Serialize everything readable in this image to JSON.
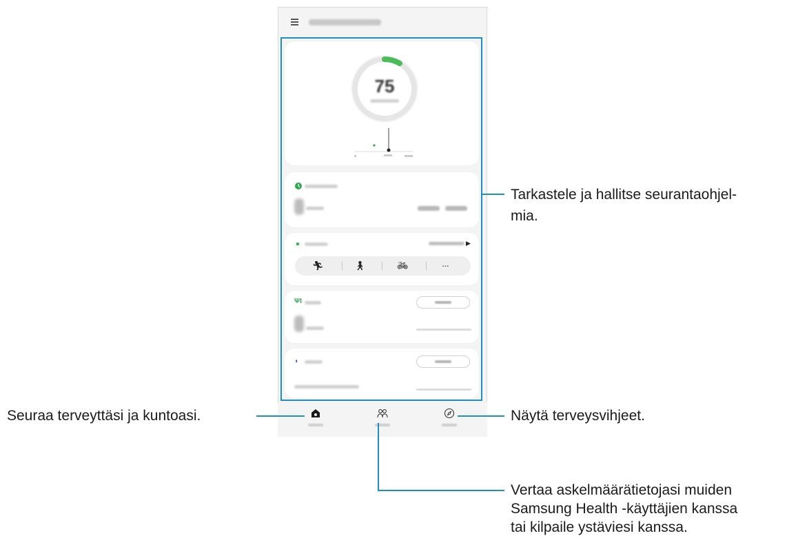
{
  "app": {
    "ring_value": "75"
  },
  "nav": {
    "items": [
      {
        "icon": "home-icon"
      },
      {
        "icon": "together-icon"
      },
      {
        "icon": "discover-icon"
      }
    ]
  },
  "exercise_icons": [
    "running-icon",
    "walking-icon",
    "cycling-icon",
    "more-icon"
  ],
  "callouts": {
    "trackers_line1": "Tarkastele ja hallitse seurantaohjel-",
    "trackers_line2": "mia.",
    "home": "Seuraa terveyttäsi ja kuntoasi.",
    "discover": "Näytä terveysvihjeet.",
    "together_line1": "Vertaa askelmäärätietojasi muiden",
    "together_line2": "Samsung Health -käyttäjien kanssa",
    "together_line3": "tai kilpaile ystäviesi kanssa."
  },
  "colors": {
    "accent": "#1e8dc2",
    "ring_progress": "#4cbb5a",
    "exercise_green": "#2fa84f",
    "sleep_blue": "#3c5bd6"
  }
}
